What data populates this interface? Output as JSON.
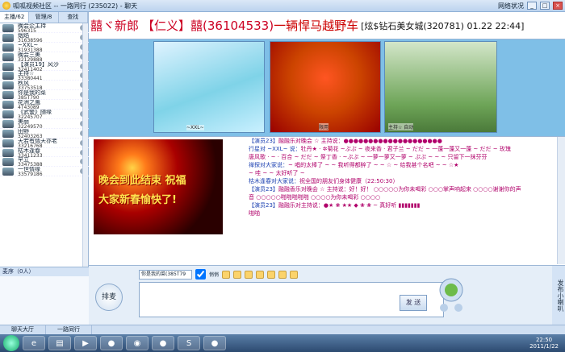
{
  "window": {
    "title": "呱呱视频社区 -- 一路同行 (235022) - 聊天",
    "status": "网络状况"
  },
  "left_tabs": [
    "主播/62",
    "管理/8",
    "查找"
  ],
  "users": [
    {
      "name": "晚会企主持",
      "id": "596315"
    },
    {
      "name": "烟焰",
      "id": "31638596"
    },
    {
      "name": "~XXL~",
      "id": "31931388"
    },
    {
      "name": "晚会三美",
      "id": "32129888"
    },
    {
      "name": "【演员19】风沙",
      "id": "32411402"
    },
    {
      "name": "主持☆",
      "id": "33380441"
    },
    {
      "name": "秋风",
      "id": "33753518"
    },
    {
      "name": "你是我的菜",
      "id": "385T790"
    },
    {
      "name": "花洲之鹰",
      "id": "4T43089"
    },
    {
      "name": "《武警》随缘",
      "id": "32245707"
    },
    {
      "name": "美丽",
      "id": "32249570"
    },
    {
      "name": "田野",
      "id": "32403263"
    },
    {
      "name": "天若有情天亦老",
      "id": "33216768"
    },
    {
      "name": "枯木逢春",
      "id": "33411233"
    },
    {
      "name": "早立",
      "id": "33475388"
    },
    {
      "name": "一世情缘",
      "id": "33579186"
    }
  ],
  "left_bottom": {
    "label": "麦序（0人）"
  },
  "marquee": {
    "p1": "囍ヾ新郎",
    "p2": "【仁义】囍(36104533)",
    "p3": "一辆悍马越野车",
    "p4": "[炫$钻石美女城(320781) 01.22 22:44]"
  },
  "videos": [
    {
      "label": "~XXL~"
    },
    {
      "label": "限用"
    },
    {
      "label": "主持☆  自动"
    }
  ],
  "banner": {
    "line1": "晚会到此结束 祝福",
    "line2": "大家新春愉快了!"
  },
  "messages": [
    {
      "who": "【演员23】",
      "txt": "融融乐对晚会 ☆ 主持说：●●●●●●●●●●●●●●●●●●●●"
    },
    {
      "who": "行星对 ~XXL~ 说：",
      "txt": "牡丹★ · ✲菊花 ~ぷぷ ~ 夜来香 · 君子兰 ~ だだ ~ 一蓬一蓬又一蓬 ~ だだ ~ 玫瑰"
    },
    {
      "who": "",
      "txt": "唐风歌 · ~ · 百合 ~ だだ ~ 祭丁香 · ~ぷぷ ~ 一萝一萝又一萝 ~ ぷぷ ~ ~ ~ 只留下一抹芬芬"
    },
    {
      "who": "禅探对大家说：",
      "txt": "~ 唱的太棒了 ~ ~ 我听得都醉了 ~ ~ ☆ ~ 给我甚个名吧 ~ ~ ☆★"
    },
    {
      "who": "",
      "txt": "~ 哇 ~ ~ 太好听了 ~"
    },
    {
      "who": "枯木逢春对大家说：",
      "txt": "祝全国的朋友们身体健康（22:50:30）"
    },
    {
      "who": "【演员23】",
      "txt": "融融香乐对晚会 ☆ 主持说：好！好！ ○○○○○为你未喝彩 ○○○掌声响起来 ○○○○谢谢你的声"
    },
    {
      "who": "",
      "txt": "音 ○○○○○啪啪啪啪啪 ○○○○为你未喝彩 ○○○○"
    },
    {
      "who": "【演员23】",
      "txt": "融融乐对主持说：●★ ❀ ★★ ◆ ❀ ❀ ~ 真好听 ▮▮▮▮▮▮▮"
    },
    {
      "who": "",
      "txt": "啪啪"
    }
  ],
  "input": {
    "paimai": "排麦",
    "target": "你是我的菜(385T79",
    "checkbox": "悄悄",
    "send": "发 送",
    "publish": "发布小喇叭"
  },
  "statusbar": [
    "聊天大厅",
    "一路同行"
  ],
  "taskbar": {
    "time": "22:50",
    "date": "2011/1/22"
  }
}
